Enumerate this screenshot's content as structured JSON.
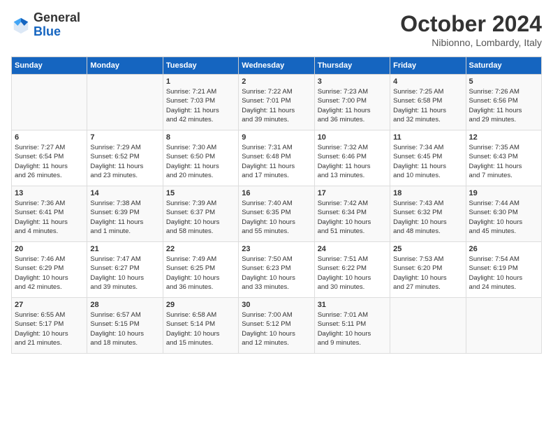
{
  "header": {
    "logo_general": "General",
    "logo_blue": "Blue",
    "month": "October 2024",
    "location": "Nibionno, Lombardy, Italy"
  },
  "calendar": {
    "days_of_week": [
      "Sunday",
      "Monday",
      "Tuesday",
      "Wednesday",
      "Thursday",
      "Friday",
      "Saturday"
    ],
    "weeks": [
      [
        {
          "day": "",
          "info": ""
        },
        {
          "day": "",
          "info": ""
        },
        {
          "day": "1",
          "info": "Sunrise: 7:21 AM\nSunset: 7:03 PM\nDaylight: 11 hours\nand 42 minutes."
        },
        {
          "day": "2",
          "info": "Sunrise: 7:22 AM\nSunset: 7:01 PM\nDaylight: 11 hours\nand 39 minutes."
        },
        {
          "day": "3",
          "info": "Sunrise: 7:23 AM\nSunset: 7:00 PM\nDaylight: 11 hours\nand 36 minutes."
        },
        {
          "day": "4",
          "info": "Sunrise: 7:25 AM\nSunset: 6:58 PM\nDaylight: 11 hours\nand 32 minutes."
        },
        {
          "day": "5",
          "info": "Sunrise: 7:26 AM\nSunset: 6:56 PM\nDaylight: 11 hours\nand 29 minutes."
        }
      ],
      [
        {
          "day": "6",
          "info": "Sunrise: 7:27 AM\nSunset: 6:54 PM\nDaylight: 11 hours\nand 26 minutes."
        },
        {
          "day": "7",
          "info": "Sunrise: 7:29 AM\nSunset: 6:52 PM\nDaylight: 11 hours\nand 23 minutes."
        },
        {
          "day": "8",
          "info": "Sunrise: 7:30 AM\nSunset: 6:50 PM\nDaylight: 11 hours\nand 20 minutes."
        },
        {
          "day": "9",
          "info": "Sunrise: 7:31 AM\nSunset: 6:48 PM\nDaylight: 11 hours\nand 17 minutes."
        },
        {
          "day": "10",
          "info": "Sunrise: 7:32 AM\nSunset: 6:46 PM\nDaylight: 11 hours\nand 13 minutes."
        },
        {
          "day": "11",
          "info": "Sunrise: 7:34 AM\nSunset: 6:45 PM\nDaylight: 11 hours\nand 10 minutes."
        },
        {
          "day": "12",
          "info": "Sunrise: 7:35 AM\nSunset: 6:43 PM\nDaylight: 11 hours\nand 7 minutes."
        }
      ],
      [
        {
          "day": "13",
          "info": "Sunrise: 7:36 AM\nSunset: 6:41 PM\nDaylight: 11 hours\nand 4 minutes."
        },
        {
          "day": "14",
          "info": "Sunrise: 7:38 AM\nSunset: 6:39 PM\nDaylight: 11 hours\nand 1 minute."
        },
        {
          "day": "15",
          "info": "Sunrise: 7:39 AM\nSunset: 6:37 PM\nDaylight: 10 hours\nand 58 minutes."
        },
        {
          "day": "16",
          "info": "Sunrise: 7:40 AM\nSunset: 6:35 PM\nDaylight: 10 hours\nand 55 minutes."
        },
        {
          "day": "17",
          "info": "Sunrise: 7:42 AM\nSunset: 6:34 PM\nDaylight: 10 hours\nand 51 minutes."
        },
        {
          "day": "18",
          "info": "Sunrise: 7:43 AM\nSunset: 6:32 PM\nDaylight: 10 hours\nand 48 minutes."
        },
        {
          "day": "19",
          "info": "Sunrise: 7:44 AM\nSunset: 6:30 PM\nDaylight: 10 hours\nand 45 minutes."
        }
      ],
      [
        {
          "day": "20",
          "info": "Sunrise: 7:46 AM\nSunset: 6:29 PM\nDaylight: 10 hours\nand 42 minutes."
        },
        {
          "day": "21",
          "info": "Sunrise: 7:47 AM\nSunset: 6:27 PM\nDaylight: 10 hours\nand 39 minutes."
        },
        {
          "day": "22",
          "info": "Sunrise: 7:49 AM\nSunset: 6:25 PM\nDaylight: 10 hours\nand 36 minutes."
        },
        {
          "day": "23",
          "info": "Sunrise: 7:50 AM\nSunset: 6:23 PM\nDaylight: 10 hours\nand 33 minutes."
        },
        {
          "day": "24",
          "info": "Sunrise: 7:51 AM\nSunset: 6:22 PM\nDaylight: 10 hours\nand 30 minutes."
        },
        {
          "day": "25",
          "info": "Sunrise: 7:53 AM\nSunset: 6:20 PM\nDaylight: 10 hours\nand 27 minutes."
        },
        {
          "day": "26",
          "info": "Sunrise: 7:54 AM\nSunset: 6:19 PM\nDaylight: 10 hours\nand 24 minutes."
        }
      ],
      [
        {
          "day": "27",
          "info": "Sunrise: 6:55 AM\nSunset: 5:17 PM\nDaylight: 10 hours\nand 21 minutes."
        },
        {
          "day": "28",
          "info": "Sunrise: 6:57 AM\nSunset: 5:15 PM\nDaylight: 10 hours\nand 18 minutes."
        },
        {
          "day": "29",
          "info": "Sunrise: 6:58 AM\nSunset: 5:14 PM\nDaylight: 10 hours\nand 15 minutes."
        },
        {
          "day": "30",
          "info": "Sunrise: 7:00 AM\nSunset: 5:12 PM\nDaylight: 10 hours\nand 12 minutes."
        },
        {
          "day": "31",
          "info": "Sunrise: 7:01 AM\nSunset: 5:11 PM\nDaylight: 10 hours\nand 9 minutes."
        },
        {
          "day": "",
          "info": ""
        },
        {
          "day": "",
          "info": ""
        }
      ]
    ]
  }
}
